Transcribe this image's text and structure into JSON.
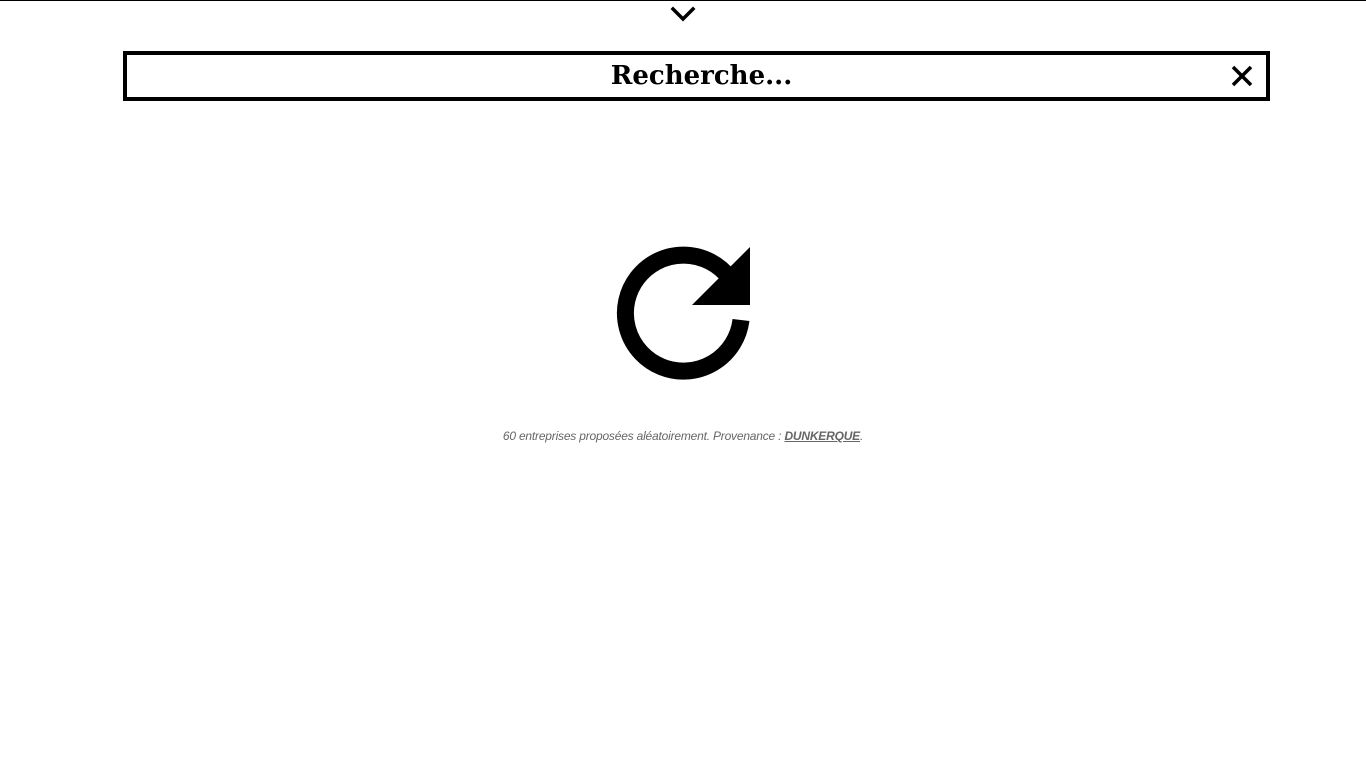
{
  "header": {
    "toggle_icon": "chevron-down-icon"
  },
  "search": {
    "placeholder": "Recherche...",
    "value": "",
    "clear_icon": "close-icon"
  },
  "main": {
    "refresh_icon": "refresh-icon",
    "info_prefix": "60 entreprises proposées aléatoirement. Provenance : ",
    "info_link": "DUNKERQUE",
    "info_suffix": "."
  },
  "colors": {
    "foreground": "#000000",
    "background": "#ffffff",
    "muted_text": "#666666"
  }
}
